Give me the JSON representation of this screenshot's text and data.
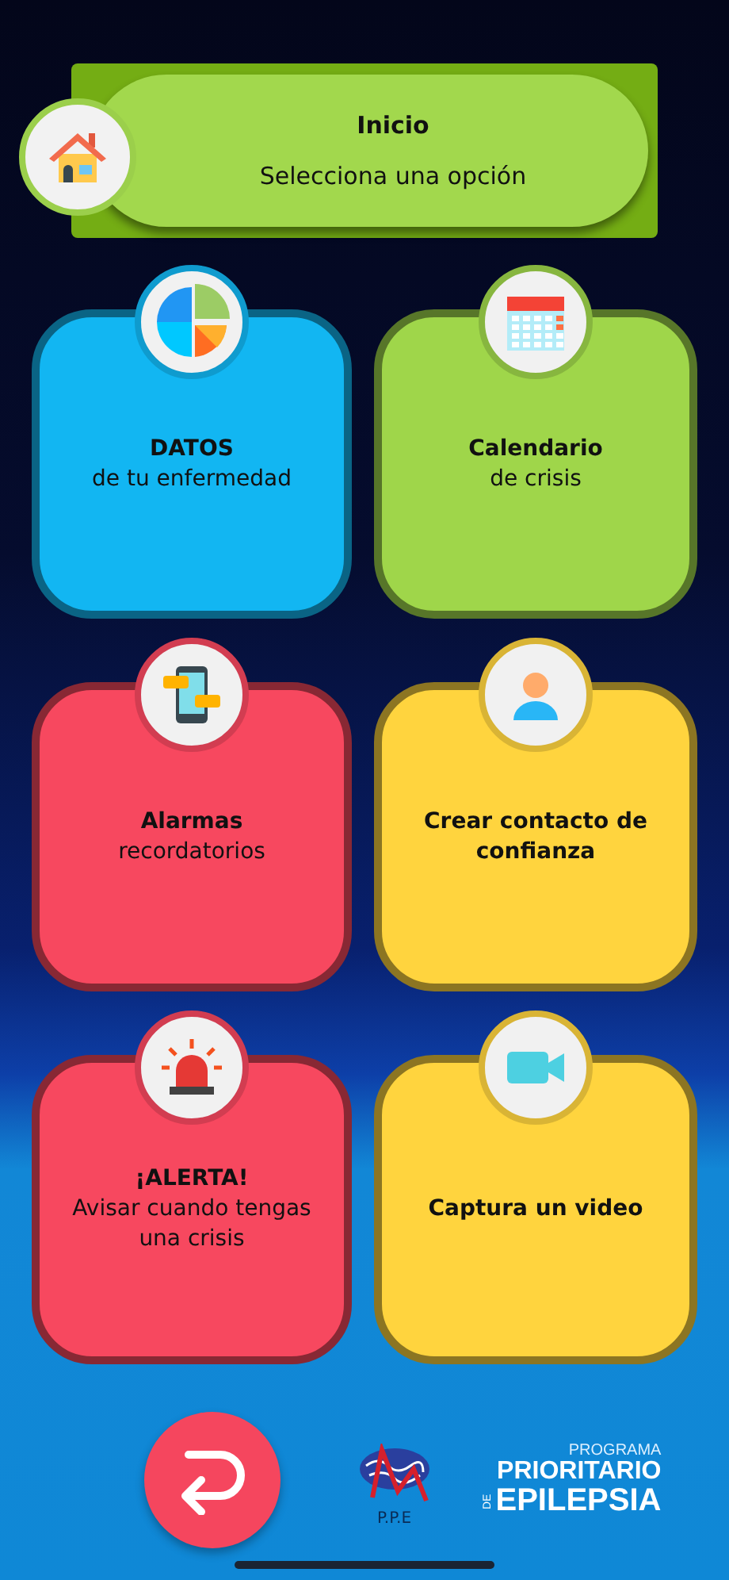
{
  "header": {
    "title": "Inicio",
    "subtitle": "Selecciona una opción"
  },
  "cards": [
    {
      "title": "DATOS",
      "subtitle": "de tu enfermedad",
      "color": "#12b6f2"
    },
    {
      "title": "Calendario",
      "subtitle": "de crisis",
      "color": "#9fd64a"
    },
    {
      "title": "Alarmas",
      "subtitle": "recordatorios",
      "color": "#f7485f"
    },
    {
      "title": "Crear contacto de confianza",
      "color": "#ffd43e"
    },
    {
      "title": "¡ALERTA!",
      "subtitle": "Avisar cuando tengas una crisis",
      "color": "#f7485f"
    },
    {
      "title": "Captura un video",
      "color": "#ffd43e"
    }
  ],
  "footer": {
    "brand_caption": "P.P.E",
    "program": {
      "line_1": "PROGRAMA",
      "line_2": "PRIORITARIO",
      "prefix": "DE",
      "line_3": "EPILEPSIA"
    }
  }
}
